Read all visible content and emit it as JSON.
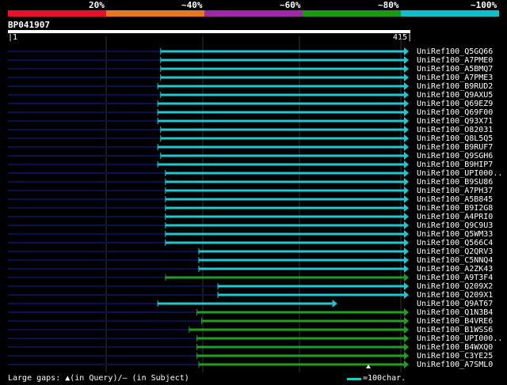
{
  "scale": {
    "labels": [
      "20%",
      "~40%",
      "~60%",
      "~80%",
      "~100%"
    ],
    "colors": [
      "#e8102a",
      "#e87820",
      "#9a2aa0",
      "#1a9a1a",
      "#10c0c8"
    ]
  },
  "query": {
    "id": "BP041907",
    "start": "1",
    "end": "415",
    "length": 415
  },
  "colors": {
    "high": "#20c8d0",
    "mid": "#20a020",
    "unaligned": "#0a1050",
    "grid": "#333333"
  },
  "hits": [
    {
      "label": "UniRef100_Q5GQ66",
      "start": 160,
      "end": 415,
      "color": "high",
      "arrow": true
    },
    {
      "label": "UniRef100_A7PME0",
      "start": 160,
      "end": 415,
      "color": "high",
      "arrow": true
    },
    {
      "label": "UniRef100_A5BMQ7",
      "start": 160,
      "end": 415,
      "color": "high",
      "arrow": true
    },
    {
      "label": "UniRef100_A7PME3",
      "start": 160,
      "end": 415,
      "color": "high",
      "arrow": true
    },
    {
      "label": "UniRef100_B9RUD2",
      "start": 157,
      "end": 415,
      "color": "high",
      "arrow": true
    },
    {
      "label": "UniRef100_Q9AXU5",
      "start": 160,
      "end": 415,
      "color": "high",
      "arrow": true
    },
    {
      "label": "UniRef100_Q69EZ9",
      "start": 157,
      "end": 415,
      "color": "high",
      "arrow": true
    },
    {
      "label": "UniRef100_Q69F00",
      "start": 157,
      "end": 415,
      "color": "high",
      "arrow": true
    },
    {
      "label": "UniRef100_Q93X71",
      "start": 157,
      "end": 415,
      "color": "high",
      "arrow": true
    },
    {
      "label": "UniRef100_O82031",
      "start": 160,
      "end": 415,
      "color": "high",
      "arrow": true
    },
    {
      "label": "UniRef100_Q8L5Q5",
      "start": 160,
      "end": 415,
      "color": "high",
      "arrow": true
    },
    {
      "label": "UniRef100_B9RUF7",
      "start": 157,
      "end": 415,
      "color": "high",
      "arrow": true
    },
    {
      "label": "UniRef100_Q9SGH6",
      "start": 160,
      "end": 415,
      "color": "high",
      "arrow": true
    },
    {
      "label": "UniRef100_B9HIP7",
      "start": 157,
      "end": 415,
      "color": "high",
      "arrow": true
    },
    {
      "label": "UniRef100_UPI000..",
      "start": 165,
      "end": 415,
      "color": "high",
      "arrow": true
    },
    {
      "label": "UniRef100_B9SU86",
      "start": 165,
      "end": 415,
      "color": "high",
      "arrow": true
    },
    {
      "label": "UniRef100_A7PH37",
      "start": 165,
      "end": 415,
      "color": "high",
      "arrow": true
    },
    {
      "label": "UniRef100_A5B845",
      "start": 165,
      "end": 415,
      "color": "high",
      "arrow": true
    },
    {
      "label": "UniRef100_B9I2G8",
      "start": 165,
      "end": 415,
      "color": "high",
      "arrow": true
    },
    {
      "label": "UniRef100_A4PRI0",
      "start": 165,
      "end": 415,
      "color": "high",
      "arrow": true
    },
    {
      "label": "UniRef100_Q9C9U3",
      "start": 165,
      "end": 415,
      "color": "high",
      "arrow": true
    },
    {
      "label": "UniRef100_Q5WM33",
      "start": 165,
      "end": 415,
      "color": "high",
      "arrow": true
    },
    {
      "label": "UniRef100_Q566C4",
      "start": 165,
      "end": 415,
      "color": "high",
      "arrow": true
    },
    {
      "label": "UniRef100_Q2QRV3",
      "start": 200,
      "end": 415,
      "color": "high",
      "arrow": true
    },
    {
      "label": "UniRef100_C5NNQ4",
      "start": 200,
      "end": 415,
      "color": "high",
      "arrow": true
    },
    {
      "label": "UniRef100_A2ZK43",
      "start": 200,
      "end": 415,
      "color": "high",
      "arrow": true
    },
    {
      "label": "UniRef100_A9T3F4",
      "start": 165,
      "end": 415,
      "color": "mid",
      "arrow": true
    },
    {
      "label": "UniRef100_Q209X2",
      "start": 220,
      "end": 415,
      "color": "high",
      "arrow": true
    },
    {
      "label": "UniRef100_Q209X1",
      "start": 220,
      "end": 415,
      "color": "high",
      "arrow": true
    },
    {
      "label": "UniRef100_Q9AT67",
      "start": 157,
      "end": 340,
      "color": "high",
      "arrow": true
    },
    {
      "label": "UniRef100_Q1N3B4",
      "start": 198,
      "end": 415,
      "color": "mid",
      "arrow": true
    },
    {
      "label": "UniRef100_B4VRE6",
      "start": 203,
      "end": 415,
      "color": "mid",
      "arrow": true
    },
    {
      "label": "UniRef100_B1WSS6",
      "start": 190,
      "end": 415,
      "color": "mid",
      "arrow": true
    },
    {
      "label": "UniRef100_UPI000..",
      "start": 198,
      "end": 415,
      "color": "mid",
      "arrow": true
    },
    {
      "label": "UniRef100_B4WXQ0",
      "start": 198,
      "end": 415,
      "color": "mid",
      "arrow": true
    },
    {
      "label": "UniRef100_C3YE25",
      "start": 198,
      "end": 415,
      "color": "mid",
      "arrow": true
    },
    {
      "label": "UniRef100_A7SML0",
      "start": 200,
      "end": 415,
      "color": "mid",
      "arrow": true
    }
  ],
  "footer": {
    "gaps_text": "Large gaps: ▲(in Query)/– (in Subject)",
    "legend_text": "=100char."
  }
}
